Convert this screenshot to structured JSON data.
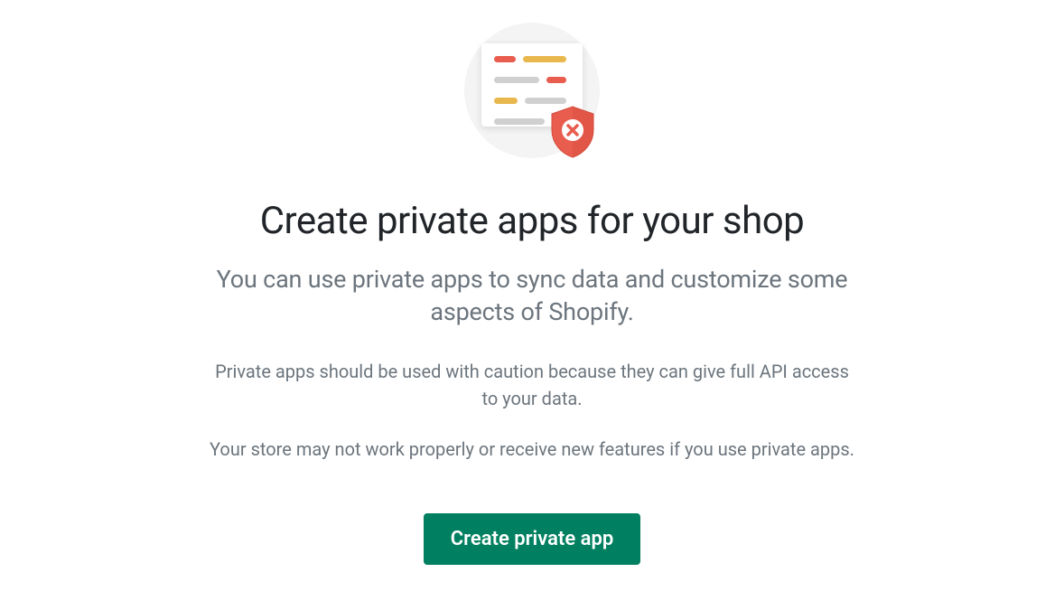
{
  "illustration": {
    "icon_name": "document-shield-x-icon"
  },
  "heading": "Create private apps for your shop",
  "subtitle": "You can use private apps to sync data and customize some aspects of Shopify.",
  "caution": "Private apps should be used with caution because they can give full API access to your data.",
  "warning": "Your store may not work properly or receive new features if you use private apps.",
  "button": {
    "label": "Create private app"
  },
  "colors": {
    "primary_button": "#008060",
    "text_heading": "#212529",
    "text_muted": "#6c757d",
    "accent_red": "#e85d4e",
    "accent_yellow": "#e8b84e"
  }
}
